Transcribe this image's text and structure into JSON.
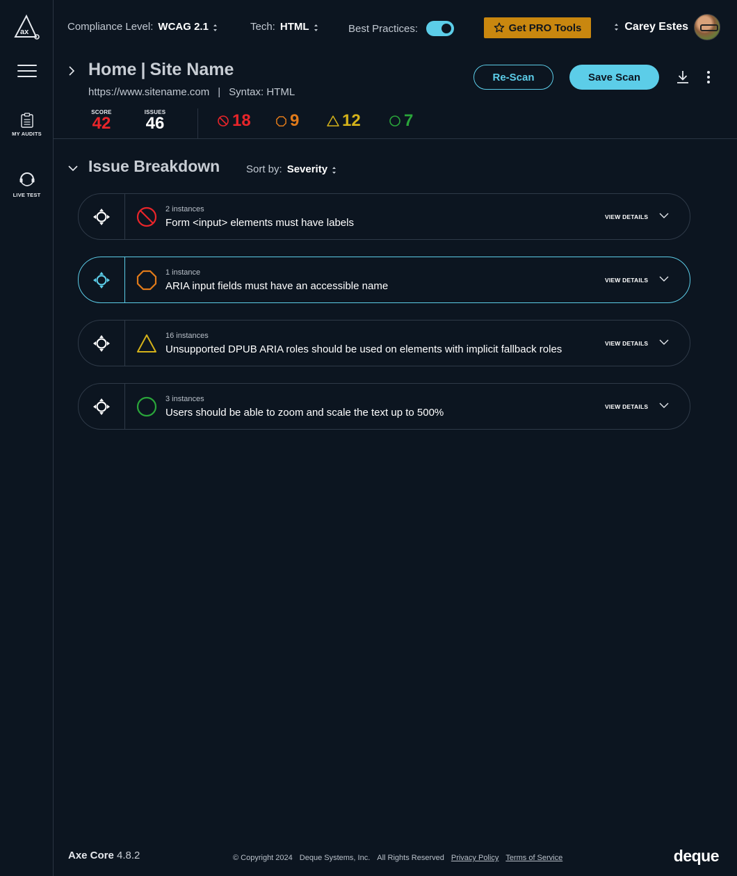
{
  "topbar": {
    "compliance_label": "Compliance Level:",
    "compliance_value": "WCAG 2.1",
    "tech_label": "Tech:",
    "tech_value": "HTML",
    "best_practices_label": "Best Practices:",
    "best_practices_on": true,
    "pro_button": "Get PRO Tools",
    "user_name": "Carey Estes"
  },
  "rail": {
    "items": [
      {
        "label": "MY AUDITS",
        "icon": "clipboard-icon"
      },
      {
        "label": "LIVE TEST",
        "icon": "headset-icon"
      }
    ]
  },
  "page": {
    "title_home": "Home",
    "title_sep": "|",
    "title_site": "Site Name",
    "url": "https://www.sitename.com",
    "sub_sep": "|",
    "syntax": "Syntax: HTML",
    "rescan_label": "Re-Scan",
    "save_label": "Save Scan",
    "score_label": "SCORE",
    "score_value": "42",
    "issues_label": "ISSUES",
    "issues_value": "46",
    "severity_counts": {
      "critical": "18",
      "serious": "9",
      "moderate": "12",
      "minor": "7"
    }
  },
  "breakdown": {
    "title": "Issue Breakdown",
    "sort_label": "Sort by:",
    "sort_value": "Severity",
    "view_details": "VIEW DETAILS",
    "issues": [
      {
        "severity": "critical",
        "instances": "2 instances",
        "description": "Form <input> elements must have labels"
      },
      {
        "severity": "serious",
        "instances": "1 instance",
        "description": "ARIA input fields must have an accessible name"
      },
      {
        "severity": "moderate",
        "instances": "16 instances",
        "description": "Unsupported DPUB ARIA roles should be used on elements with implicit fallback roles"
      },
      {
        "severity": "minor",
        "instances": "3 instances",
        "description": "Users should be able to zoom and scale the text up to 500%"
      }
    ]
  },
  "footer": {
    "brand": "Axe Core",
    "version": "4.8.2",
    "copyright": "© Copyright 2024",
    "company": "Deque Systems, Inc.",
    "rights": "All Rights Reserved",
    "privacy": "Privacy Policy",
    "terms": "Terms of Service",
    "logo": "deque"
  },
  "colors": {
    "background": "#0c1520",
    "accent": "#5ccde8",
    "pro": "#c9870f",
    "critical": "#e8252a",
    "serious": "#e07a1a",
    "moderate": "#d4b21a",
    "minor": "#2aa53a"
  }
}
